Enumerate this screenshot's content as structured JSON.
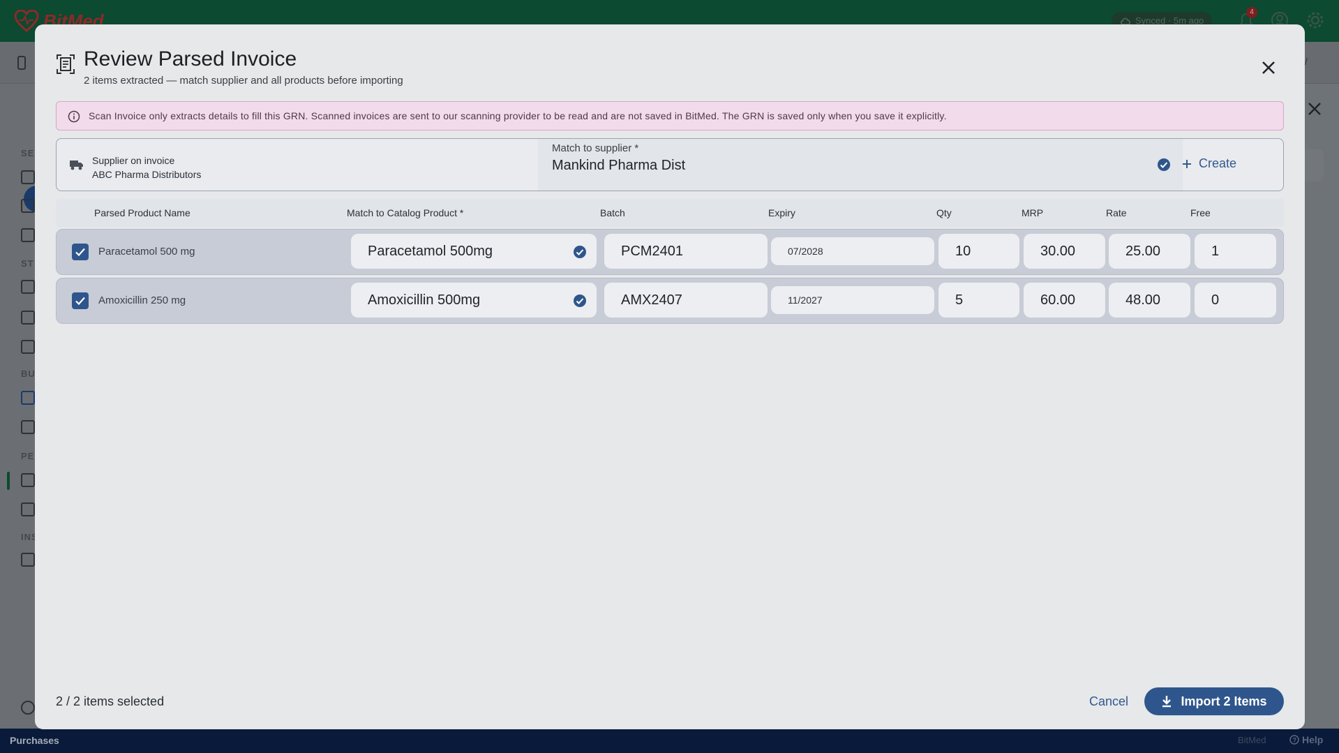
{
  "app": {
    "logo_text": "BitMed",
    "sync_status": "Synced · 5m ago",
    "notification_count": "4",
    "bottom_section": "Purchases",
    "bottom_brand": "BitMed",
    "help_label": "Help",
    "sidebar_letters": [
      "SE",
      "ST",
      "BU",
      "PE",
      "INS"
    ],
    "secondbar_right_text": "W"
  },
  "modal": {
    "title": "Review Parsed Invoice",
    "subtitle": "2 items extracted — match supplier and all products before importing",
    "notice": "Scan Invoice only extracts details to fill this GRN. Scanned invoices are sent to our scanning provider to be read and are not saved in BitMed. The GRN is saved only when you save it explicitly.",
    "supplier": {
      "label": "Supplier on invoice",
      "value": "ABC Pharma Distributors",
      "match_label": "Match to supplier *",
      "match_value": "Mankind Pharma Dist",
      "create_label": "Create"
    },
    "columns": [
      "Parsed Product Name",
      "Match to Catalog Product *",
      "Batch",
      "Expiry",
      "Qty",
      "MRP",
      "Rate",
      "Free"
    ],
    "rows": [
      {
        "parsed": "Paracetamol 500 mg",
        "catalog": "Paracetamol 500mg",
        "batch": "PCM2401",
        "expiry": "07/2028",
        "qty": "10",
        "mrp": "30.00",
        "rate": "25.00",
        "free": "1",
        "checked": true
      },
      {
        "parsed": "Amoxicillin 250 mg",
        "catalog": "Amoxicillin 500mg",
        "batch": "AMX2407",
        "expiry": "11/2027",
        "qty": "5",
        "mrp": "60.00",
        "rate": "48.00",
        "free": "0",
        "checked": true
      }
    ],
    "footer": {
      "selected_text": "2 / 2 items selected",
      "cancel_label": "Cancel",
      "import_label": "Import 2 Items"
    }
  },
  "colors": {
    "accent": "#2f568c",
    "topbar": "#0c4a31",
    "notice_bg": "#f2dbea",
    "bottombar": "#0a1a3a"
  }
}
